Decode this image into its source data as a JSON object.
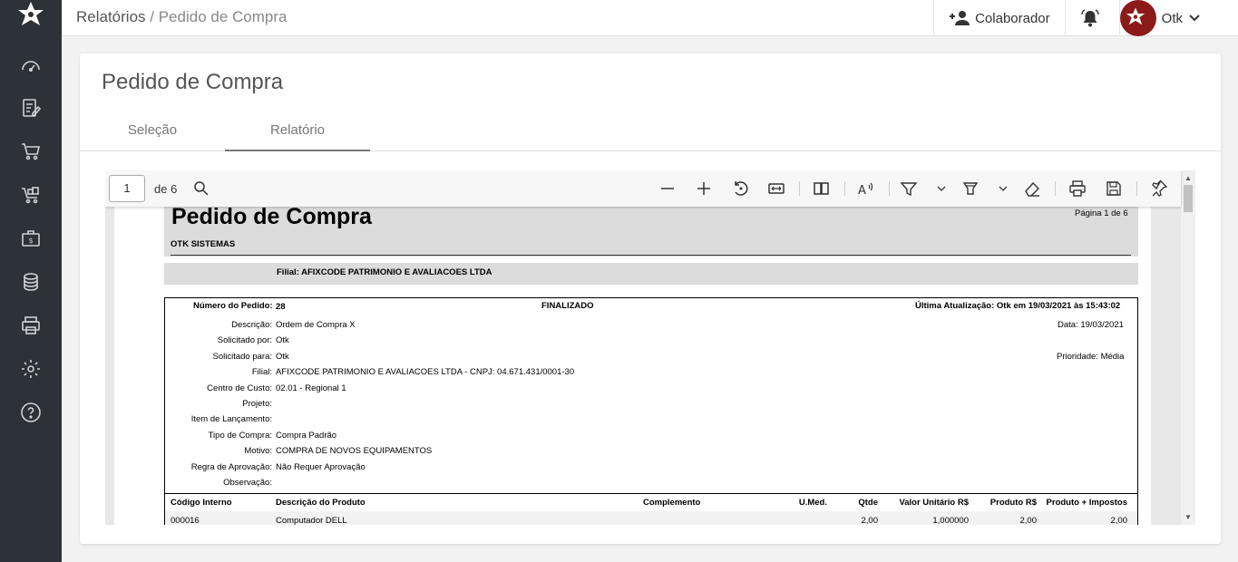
{
  "topbar": {
    "breadcrumb_root": "Relatórios",
    "breadcrumb_sep": " / ",
    "breadcrumb_current": "Pedido de Compra",
    "colaborador_label": "Colaborador",
    "user_name": "Otk"
  },
  "sidebar": {
    "items": [
      "dashboard-icon",
      "edit-document-icon",
      "cart-icon",
      "cart-items-icon",
      "briefcase-money-icon",
      "coins-stack-icon",
      "printer-icon",
      "gear-icon",
      "help-icon"
    ]
  },
  "card": {
    "title": "Pedido de Compra",
    "tabs": [
      "Seleção",
      "Relatório"
    ]
  },
  "viewer": {
    "page_number": "1",
    "page_of": "de 6"
  },
  "report": {
    "title": "Pedido de Compra",
    "page_label": "Página 1 de 6",
    "company": "OTK SISTEMAS",
    "filial_header": "Filial:  AFIXCODE PATRIMONIO E AVALIACOES LTDA",
    "numero_label": "Número do Pedido:",
    "numero_value": "28",
    "status": "FINALIZADO",
    "ultima_atualizacao": "Última Atualização: Otk  em  19/03/2021 às 15:43:02",
    "data": "Data: 19/03/2021",
    "prioridade": "Prioridade: Média",
    "fields": [
      {
        "label": "Descrição:",
        "value": "Ordem de Compra X"
      },
      {
        "label": "Solicitado por:",
        "value": "Otk"
      },
      {
        "label": "Solicitado para:",
        "value": "Otk"
      },
      {
        "label": "Filial:",
        "value": "AFIXCODE PATRIMONIO E AVALIACOES LTDA - CNPJ: 04.671.431/0001-30"
      },
      {
        "label": "Centro de Custo:",
        "value": "02.01 - Regional 1"
      },
      {
        "label": "Projeto:",
        "value": ""
      },
      {
        "label": "Item de Lançamento:",
        "value": ""
      },
      {
        "label": "Tipo de Compra:",
        "value": "Compra Padrão"
      },
      {
        "label": "Motivo:",
        "value": "COMPRA DE NOVOS EQUIPAMENTOS"
      },
      {
        "label": "Regra de Aprovação:",
        "value": "Não Requer Aprovação"
      },
      {
        "label": "Observação:",
        "value": ""
      }
    ],
    "columns": [
      "Código Interno",
      "Descrição do Produto",
      "Complemento",
      "U.Med.",
      "Qtde",
      "Valor Unitário R$",
      "Produto R$",
      "Produto + Impostos"
    ],
    "rows": [
      [
        "000016",
        "Computador DELL",
        "",
        "",
        "2,00",
        "1,000000",
        "2,00",
        "2,00"
      ]
    ]
  }
}
